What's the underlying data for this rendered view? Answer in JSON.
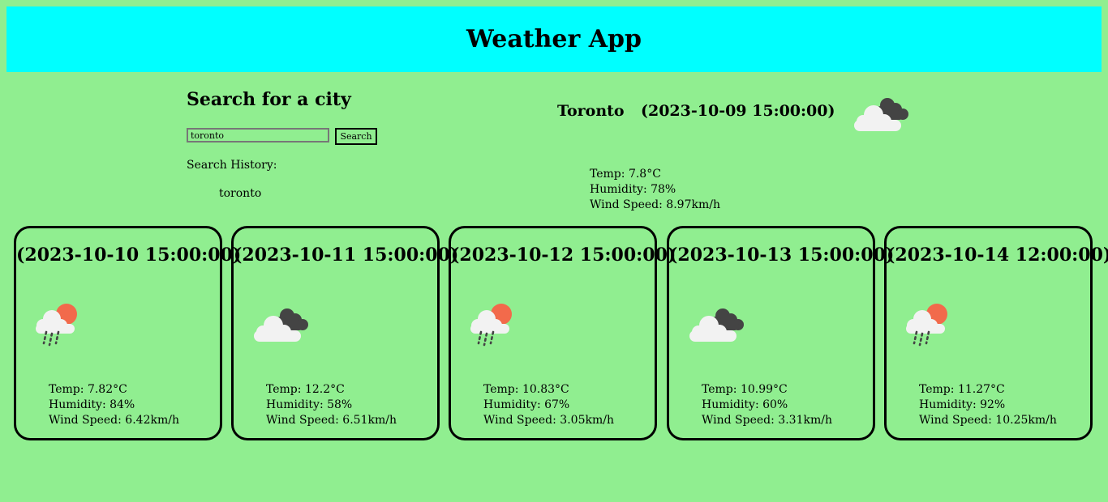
{
  "app": {
    "title": "Weather App"
  },
  "search": {
    "title": "Search for a city",
    "input_value": "toronto",
    "button_label": "Search",
    "history_label": "Search History:",
    "history": [
      "toronto"
    ]
  },
  "current": {
    "city": "Toronto",
    "date": "(2023-10-09 15:00:00)",
    "icon": "cloudy-icon",
    "temp": "Temp: 7.8°C",
    "humidity": "Humidity: 78%",
    "wind": "Wind Speed: 8.97km/h"
  },
  "forecast": [
    {
      "date": "(2023-10-10 15:00:00)",
      "icon": "rain-sun-icon",
      "temp": "Temp: 7.82°C",
      "humidity": "Humidity: 84%",
      "wind": "Wind Speed: 6.42km/h"
    },
    {
      "date": "(2023-10-11 15:00:00)",
      "icon": "cloudy-icon",
      "temp": "Temp: 12.2°C",
      "humidity": "Humidity: 58%",
      "wind": "Wind Speed: 6.51km/h"
    },
    {
      "date": "(2023-10-12 15:00:00)",
      "icon": "rain-sun-icon",
      "temp": "Temp: 10.83°C",
      "humidity": "Humidity: 67%",
      "wind": "Wind Speed: 3.05km/h"
    },
    {
      "date": "(2023-10-13 15:00:00)",
      "icon": "cloudy-icon",
      "temp": "Temp: 10.99°C",
      "humidity": "Humidity: 60%",
      "wind": "Wind Speed: 3.31km/h"
    },
    {
      "date": "(2023-10-14 12:00:00)",
      "icon": "rain-sun-icon",
      "temp": "Temp: 11.27°C",
      "humidity": "Humidity: 92%",
      "wind": "Wind Speed: 10.25km/h"
    }
  ],
  "colors": {
    "background": "#90EE90",
    "header": "#00FFFF",
    "sun": "#F26A4B",
    "dark_cloud": "#444444",
    "light_cloud": "#F2F2F2"
  }
}
